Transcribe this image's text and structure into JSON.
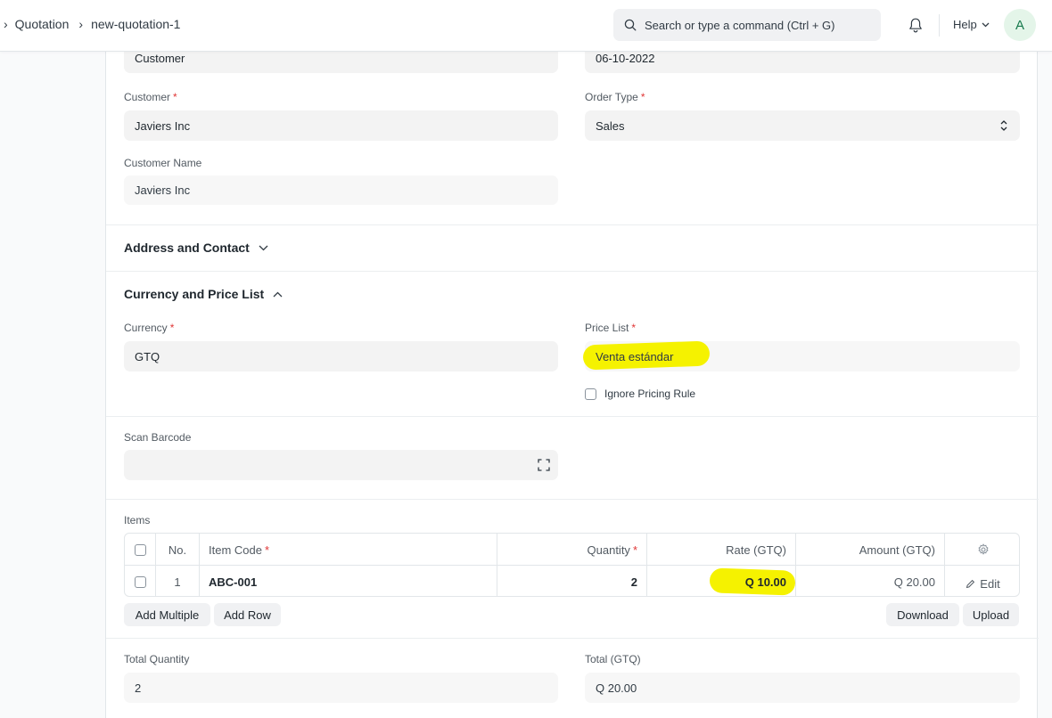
{
  "breadcrumb": {
    "items": [
      "Quotation",
      "new-quotation-1"
    ]
  },
  "search": {
    "placeholder": "Search or type a command (Ctrl + G)"
  },
  "navbar": {
    "help_label": "Help",
    "avatar_initial": "A"
  },
  "form": {
    "quotation_to_value": "Customer",
    "date_value": "06-10-2022",
    "customer": {
      "label": "Customer",
      "value": "Javiers Inc"
    },
    "order_type": {
      "label": "Order Type",
      "value": "Sales"
    },
    "customer_name": {
      "label": "Customer Name",
      "value": "Javiers Inc"
    },
    "address_section_title": "Address and Contact",
    "currency_section_title": "Currency and Price List",
    "currency": {
      "label": "Currency",
      "value": "GTQ"
    },
    "price_list": {
      "label": "Price List",
      "value": "Venta estándar"
    },
    "ignore_pricing_rule_label": "Ignore Pricing Rule",
    "scan_barcode_label": "Scan Barcode",
    "items_label": "Items",
    "totals": {
      "total_quantity_label": "Total Quantity",
      "total_quantity_value": "2",
      "total_label": "Total (GTQ)",
      "total_value": "Q 20.00"
    }
  },
  "items_table": {
    "columns": {
      "no": "No.",
      "item_code": "Item Code",
      "quantity": "Quantity",
      "rate": "Rate (GTQ)",
      "amount": "Amount (GTQ)"
    },
    "rows": [
      {
        "no": "1",
        "item_code": "ABC-001",
        "quantity": "2",
        "rate": "Q 10.00",
        "amount": "Q 20.00",
        "edit_label": "Edit"
      }
    ],
    "buttons": {
      "add_multiple": "Add Multiple",
      "add_row": "Add Row",
      "download": "Download",
      "upload": "Upload"
    }
  },
  "colors": {
    "highlight": "#f5f200",
    "required": "#e03636",
    "avatar_bg": "#e4f5e9",
    "avatar_text": "#16794c"
  }
}
